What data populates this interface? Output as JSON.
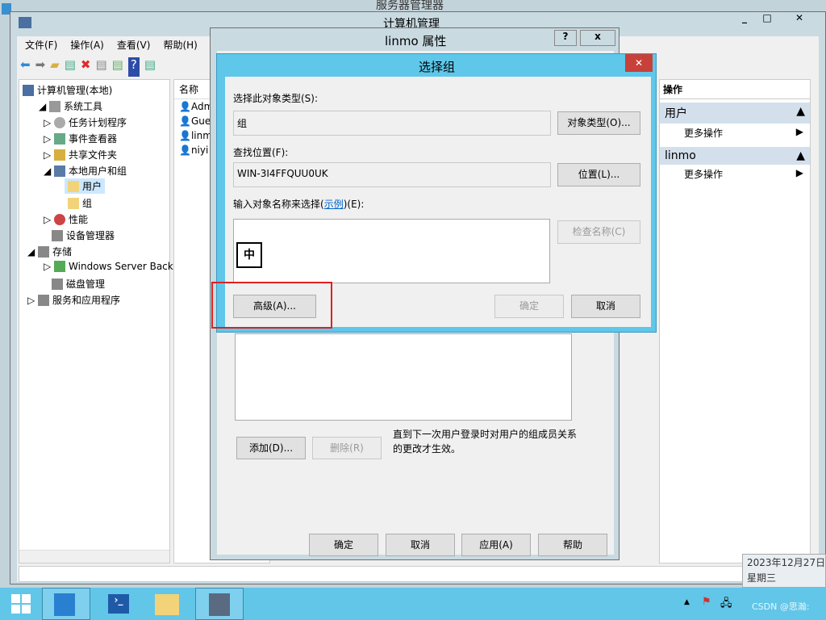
{
  "background_window": {
    "title": "服务器管理器"
  },
  "main_window": {
    "title": "计算机管理",
    "menu": [
      "文件(F)",
      "操作(A)",
      "查看(V)",
      "帮助(H)"
    ],
    "tree": {
      "root": "计算机管理(本地)",
      "system_tools": "系统工具",
      "task_scheduler": "任务计划程序",
      "event_viewer": "事件查看器",
      "shared_folders": "共享文件夹",
      "local_users": "本地用户和组",
      "users": "用户",
      "groups": "组",
      "performance": "性能",
      "device_manager": "设备管理器",
      "storage": "存储",
      "wsb": "Windows Server Back",
      "disk_mgmt": "磁盘管理",
      "services": "服务和应用程序"
    },
    "list": {
      "header": "名称",
      "rows": [
        "Adm",
        "Gue",
        "linm",
        "niyi"
      ]
    },
    "actions": {
      "header": "操作",
      "section1": "用户",
      "more1": "更多操作",
      "section2": "linmo",
      "more2": "更多操作"
    }
  },
  "properties_dialog": {
    "title": "linmo 属性",
    "help": "?",
    "close": "x",
    "add": "添加(D)...",
    "remove": "删除(R)",
    "note": "直到下一次用户登录时对用户的组成员关系的更改才生效。",
    "ok": "确定",
    "cancel": "取消",
    "apply": "应用(A)",
    "help_btn": "帮助"
  },
  "select_group": {
    "title": "选择组",
    "object_type_label": "选择此对象类型(S):",
    "object_type_value": "组",
    "object_type_btn": "对象类型(O)...",
    "location_label": "查找位置(F):",
    "location_value": "WIN-3I4FFQUU0UK",
    "location_btn": "位置(L)...",
    "enter_label_pre": "输入对象名称来选择(",
    "enter_link": "示例",
    "enter_label_post": ")(E):",
    "ime": "中",
    "check_names": "检查名称(C)",
    "advanced": "高级(A)...",
    "ok": "确定",
    "cancel": "取消"
  },
  "taskbar": {
    "date": "2023年12月27日",
    "weekday": "星期三",
    "watermark": "CSDN @思瀚:"
  },
  "colors": {
    "taskbar": "#62c6e8",
    "dialog_title": "#5fc7ea",
    "close_red": "#c7413a",
    "highlight": "#e02020"
  }
}
